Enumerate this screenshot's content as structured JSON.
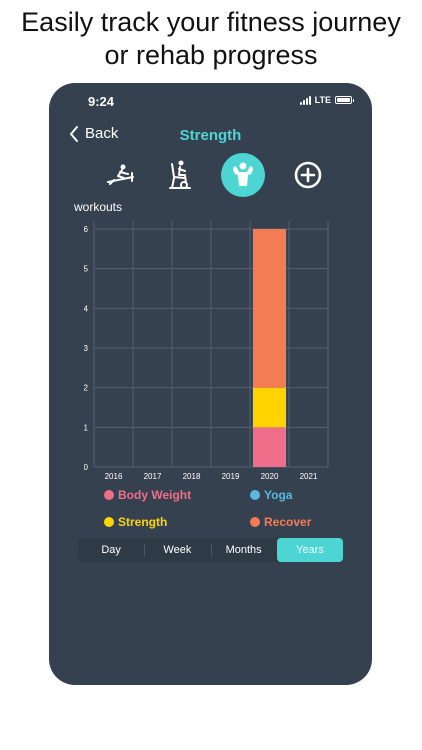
{
  "headline": [
    "Easily track your fitness journey",
    "or rehab progress"
  ],
  "status": {
    "time": "9:24",
    "network": "LTE"
  },
  "nav": {
    "back_label": "Back",
    "title": "Strength"
  },
  "workout_icons": [
    {
      "name": "rowing-machine-icon",
      "active": false
    },
    {
      "name": "seated-exercise-icon",
      "active": false
    },
    {
      "name": "strength-flex-icon",
      "active": true
    },
    {
      "name": "add-circle-icon",
      "active": false
    }
  ],
  "chart_label": "workouts",
  "legend": [
    {
      "label": "Body Weight",
      "color": "#f06e8a"
    },
    {
      "label": "Yoga",
      "color": "#5ab7e0"
    },
    {
      "label": "Strength",
      "color": "#ffd400"
    },
    {
      "label": "Recover",
      "color": "#f47c54"
    }
  ],
  "segments": [
    {
      "label": "Day",
      "active": false
    },
    {
      "label": "Week",
      "active": false
    },
    {
      "label": "Months",
      "active": false
    },
    {
      "label": "Years",
      "active": true
    }
  ],
  "colors": {
    "accent": "#4dd5d3",
    "panel": "#364150"
  },
  "chart_data": {
    "type": "bar",
    "stacked": true,
    "categories": [
      "2016",
      "2017",
      "2018",
      "2019",
      "2020",
      "2021"
    ],
    "series": [
      {
        "name": "Body Weight",
        "color": "#f06e8a",
        "values": [
          0,
          0,
          0,
          0,
          1,
          0
        ]
      },
      {
        "name": "Strength",
        "color": "#ffd400",
        "values": [
          0,
          0,
          0,
          0,
          1,
          0
        ]
      },
      {
        "name": "Recover",
        "color": "#f47c54",
        "values": [
          0,
          0,
          0,
          0,
          4,
          0
        ]
      },
      {
        "name": "Yoga",
        "color": "#5ab7e0",
        "values": [
          0,
          0,
          0,
          0,
          0,
          0
        ]
      }
    ],
    "yticks": [
      0,
      1,
      2,
      3,
      4,
      5,
      6
    ],
    "ylim": [
      0,
      6
    ],
    "ylabel": "workouts",
    "grid": true
  }
}
